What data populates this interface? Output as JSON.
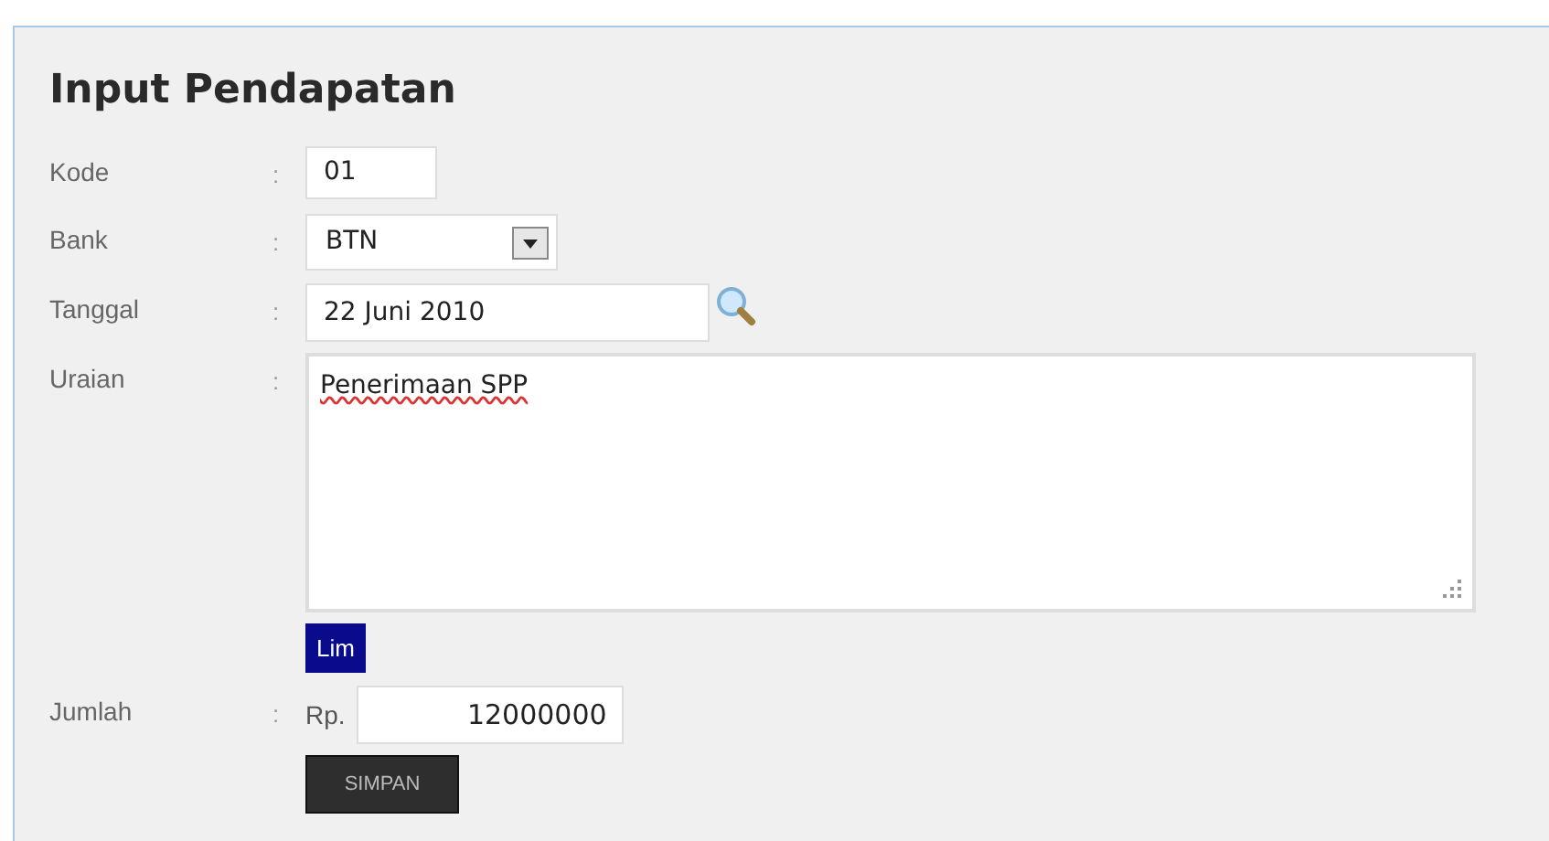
{
  "title": "Input Pendapatan",
  "fields": [
    {
      "kind": "text",
      "label": "Kode",
      "separator": ":",
      "value": "01"
    },
    {
      "kind": "select",
      "label": "Bank",
      "separator": ":",
      "value": "BTN"
    },
    {
      "kind": "date",
      "label": "Tanggal",
      "separator": ":",
      "value": "22 Juni 2010"
    },
    {
      "kind": "textarea",
      "label": "Uraian",
      "separator": ":",
      "value": "Penerimaan SPP"
    },
    {
      "kind": "extra-button",
      "label": "Lim"
    },
    {
      "kind": "money",
      "label": "Jumlah",
      "separator": ":",
      "prefix": "Rp.",
      "value": "12000000"
    }
  ],
  "submit": "SIMPAN"
}
